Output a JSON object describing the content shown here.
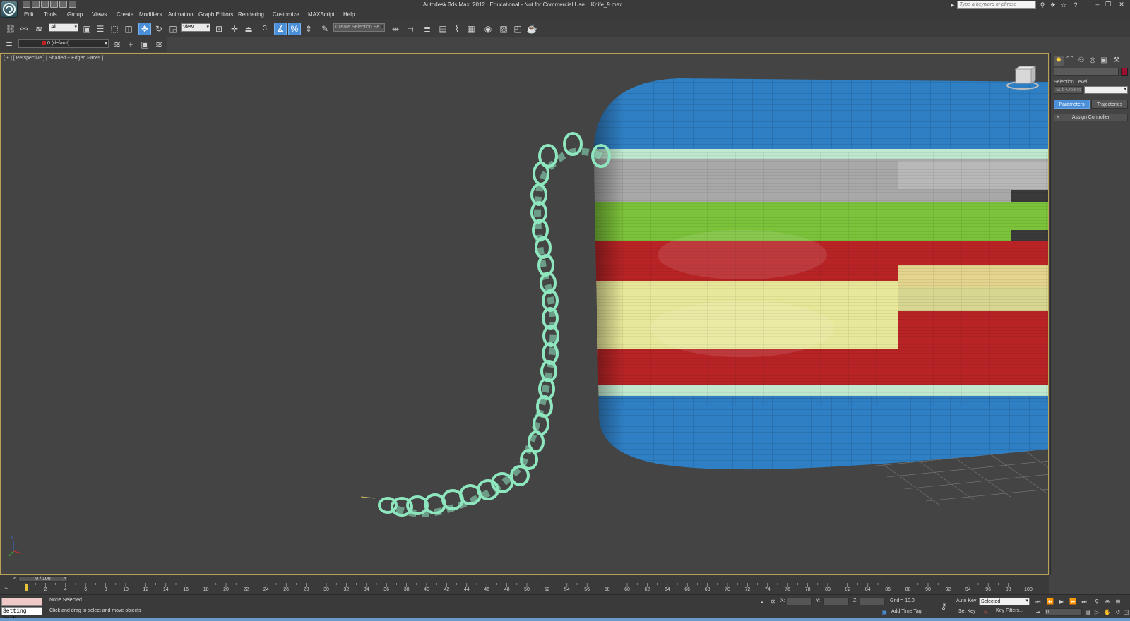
{
  "window": {
    "title": "Autodesk 3ds Max  2012   Educational - Not for Commercial Use    Knife_9.max",
    "search_placeholder": "Type a keyword or phrase"
  },
  "menu": [
    "Edit",
    "Tools",
    "Group",
    "Views",
    "Create",
    "Modifiers",
    "Animation",
    "Graph Editors",
    "Rendering",
    "Customize",
    "MAXScript",
    "Help"
  ],
  "toolbar": {
    "selection_filter": "All",
    "reference_coord": "View",
    "snap_label": "3",
    "named_selection": "Create Selection Se"
  },
  "layer": {
    "name": "0 (default)"
  },
  "viewport": {
    "label": "[ + ] [ Perspective ] [ Shaded + Edged Faces ]",
    "object_colors": {
      "blue": "#2f7fc4",
      "white_strip": "#bfe8cf",
      "gray": "#a8a8a8",
      "green": "#7cc23a",
      "red": "#b82426",
      "yellow": "#e8e89a",
      "chain": "#8ee6bf"
    }
  },
  "command_panel": {
    "selection_level_label": "Selection Level:",
    "sub_object_label": "Sub-Object",
    "tabs": [
      "Parameters",
      "Trajectories"
    ],
    "rollout": "Assign Controller",
    "object_color": "#9b1030"
  },
  "time": {
    "slider_label": "0 / 100",
    "prev": "<",
    "next": ">",
    "ticks": [
      "2",
      "4",
      "6",
      "8",
      "10",
      "12",
      "14",
      "16",
      "18",
      "20",
      "22",
      "24",
      "26",
      "28",
      "30",
      "32",
      "34",
      "36",
      "38",
      "40",
      "42",
      "44",
      "46",
      "48",
      "50",
      "52",
      "54",
      "56",
      "58",
      "60",
      "62",
      "64",
      "66",
      "68",
      "70",
      "72",
      "74",
      "76",
      "78",
      "80",
      "82",
      "84",
      "86",
      "88",
      "90",
      "92",
      "94",
      "96",
      "98",
      "100"
    ]
  },
  "status": {
    "listener_output": "Setting Path",
    "selection": "None Selected",
    "prompt": "Click and drag to select and move objects",
    "x_label": "X:",
    "y_label": "Y:",
    "z_label": "Z:",
    "grid": "Grid = 10.0",
    "add_time_tag": "Add Time Tag",
    "auto_key": "Auto Key",
    "set_key": "Set Key",
    "key_mode": "Selected",
    "key_filters": "Key Filters...",
    "frame": "0"
  }
}
